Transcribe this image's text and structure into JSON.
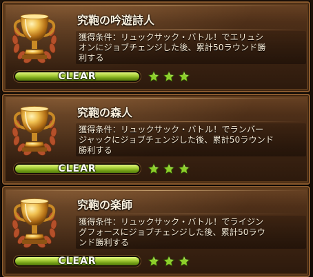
{
  "achievements": [
    {
      "title": "究鞄の吟遊詩人",
      "desc_lines": [
        "獲得条件：リュックサック・バトル！でエリュシ",
        "オンにジョブチェンジした後、累計50ラウンド勝",
        "利する"
      ],
      "status": "CLEAR",
      "progress": 1.0,
      "stars": 3
    },
    {
      "title": "究鞄の森人",
      "desc_lines": [
        "獲得条件：リュックサック・バトル！でランバー",
        "ジャックにジョブチェンジした後、累計50ラウンド",
        "勝利する"
      ],
      "status": "CLEAR",
      "progress": 1.0,
      "stars": 3
    },
    {
      "title": "究鞄の楽師",
      "desc_lines": [
        "獲得条件：リュックサック・バトル！でライジン",
        "グフォースにジョブチェンジした後、累計50ラウ",
        "ンド勝利する"
      ],
      "status": "CLEAR",
      "progress": 1.0,
      "stars": 3
    }
  ],
  "colors": {
    "star": "#8ccf2a",
    "bar_fill": "#a9d03a",
    "trophy_gold": "#e0a53a",
    "wreath": "#b5502a"
  },
  "icons": {
    "trophy": "trophy-icon",
    "star": "star-icon"
  }
}
